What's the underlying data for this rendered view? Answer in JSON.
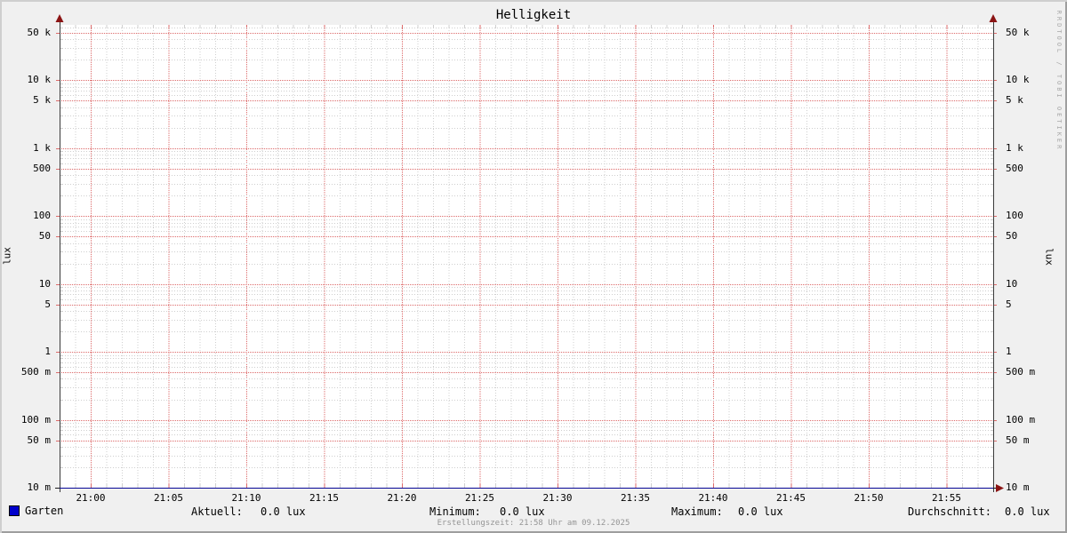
{
  "title": "Helligkeit",
  "watermark": "RRDTOOL / TOBI OETIKER",
  "footer": "Erstellungszeit: 21:58 Uhr am 09.12.2025",
  "axis": {
    "left_label": "lux",
    "right_label": "lux"
  },
  "legend": {
    "series_label": "Garten",
    "series_color": "#0000cc"
  },
  "stats": [
    {
      "label": "Aktuell:",
      "value": "0.0 lux"
    },
    {
      "label": "Minimum:",
      "value": "0.0 lux"
    },
    {
      "label": "Maximum:",
      "value": "0.0 lux"
    },
    {
      "label": "Durchschnitt:",
      "value": "0.0 lux"
    }
  ],
  "colors": {
    "background": "#f0f0f0",
    "canvas": "#ffffff",
    "shade_top_left": "#cfcfcf",
    "shade_bottom_right": "#9e9e9e",
    "grid_minor": "#cfcfcf",
    "grid_major": "#dd6a6a",
    "axis": "#1a1a1a",
    "y_axis": "#3a3a3a",
    "arrow": "#8b1414",
    "series": "#0000cc"
  },
  "chart_data": {
    "type": "line",
    "title": "Helligkeit",
    "ylabel": "lux",
    "y_scale": "log",
    "ylim": [
      0.01,
      65000
    ],
    "y_major_tick_labels": [
      "10 m",
      "50 m",
      "100 m",
      "500 m",
      "1",
      "5",
      "10",
      "50",
      "100",
      "500",
      "1 k",
      "5 k",
      "10 k",
      "50 k"
    ],
    "x_start": "20:58",
    "x_end": "21:58",
    "x_tick_labels": [
      "21:00",
      "21:05",
      "21:10",
      "21:15",
      "21:20",
      "21:25",
      "21:30",
      "21:35",
      "21:40",
      "21:45",
      "21:50",
      "21:55"
    ],
    "x_minor_step_minutes": 1,
    "x_major_step_minutes": 5,
    "grid": true,
    "legend_position": "bottom-left",
    "series": [
      {
        "name": "Garten",
        "color": "#0000cc",
        "constant_value": 0.0,
        "current": 0.0,
        "minimum": 0.0,
        "maximum": 0.0,
        "average": 0.0,
        "unit": "lux"
      }
    ]
  }
}
